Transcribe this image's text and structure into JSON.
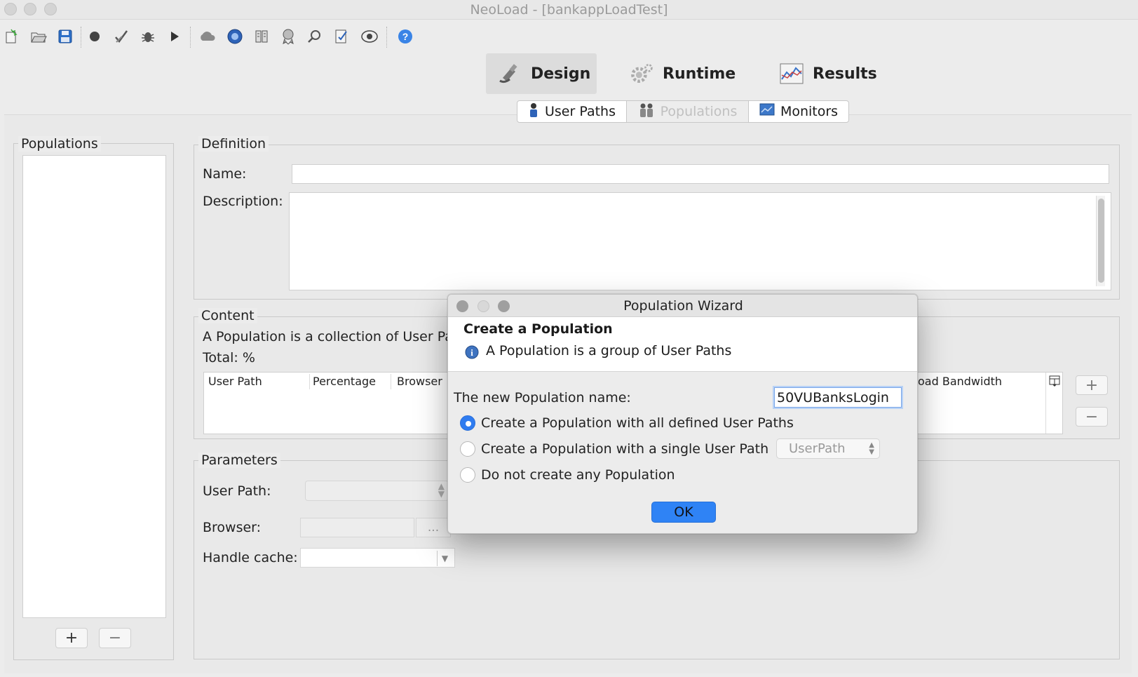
{
  "window": {
    "title": "NeoLoad - [bankappLoadTest]"
  },
  "toolbar": {
    "icons": [
      "new-project-icon",
      "open-project-icon",
      "save-icon",
      "record-icon",
      "check-icon",
      "debug-icon",
      "run-icon",
      "cloud-icon",
      "neotys-icon",
      "server-icon",
      "award-icon",
      "search-icon",
      "checklist-icon",
      "monitor-icon",
      "help-icon"
    ]
  },
  "mode_tabs": [
    {
      "label": "Design",
      "active": true
    },
    {
      "label": "Runtime",
      "active": false
    },
    {
      "label": "Results",
      "active": false
    }
  ],
  "sub_tabs": [
    {
      "label": "User Paths"
    },
    {
      "label": "Populations",
      "selected": true
    },
    {
      "label": "Monitors"
    }
  ],
  "left_panel": {
    "title": "Populations",
    "add_label": "+",
    "remove_label": "−"
  },
  "definition": {
    "title": "Definition",
    "name_label": "Name:",
    "name_value": "",
    "description_label": "Description:",
    "description_value": ""
  },
  "content": {
    "title": "Content",
    "info_text": "A Population is a collection of User Pa",
    "total_label": "Total: %",
    "columns": [
      "User Path",
      "Percentage",
      "Browser",
      "oad Bandwidth"
    ],
    "add_label": "+",
    "remove_label": "−"
  },
  "parameters": {
    "title": "Parameters",
    "user_path_label": "User Path:",
    "browser_label": "Browser:",
    "browser_button": "...",
    "handle_cache_label": "Handle cache:"
  },
  "dialog": {
    "title": "Population Wizard",
    "header_title": "Create a Population",
    "header_info": "A Population is a group of User Paths",
    "name_label": "The new Population name:",
    "name_value": "50VUBanksLogin",
    "options": [
      {
        "label": "Create a Population with all defined User Paths",
        "selected": true
      },
      {
        "label": "Create a Population with a single User Path",
        "selected": false
      },
      {
        "label": "Do not create any Population",
        "selected": false
      }
    ],
    "userpath_select": "UserPath",
    "ok_label": "OK"
  },
  "colors": {
    "accent": "#2f83f5",
    "background": "#ececec"
  }
}
